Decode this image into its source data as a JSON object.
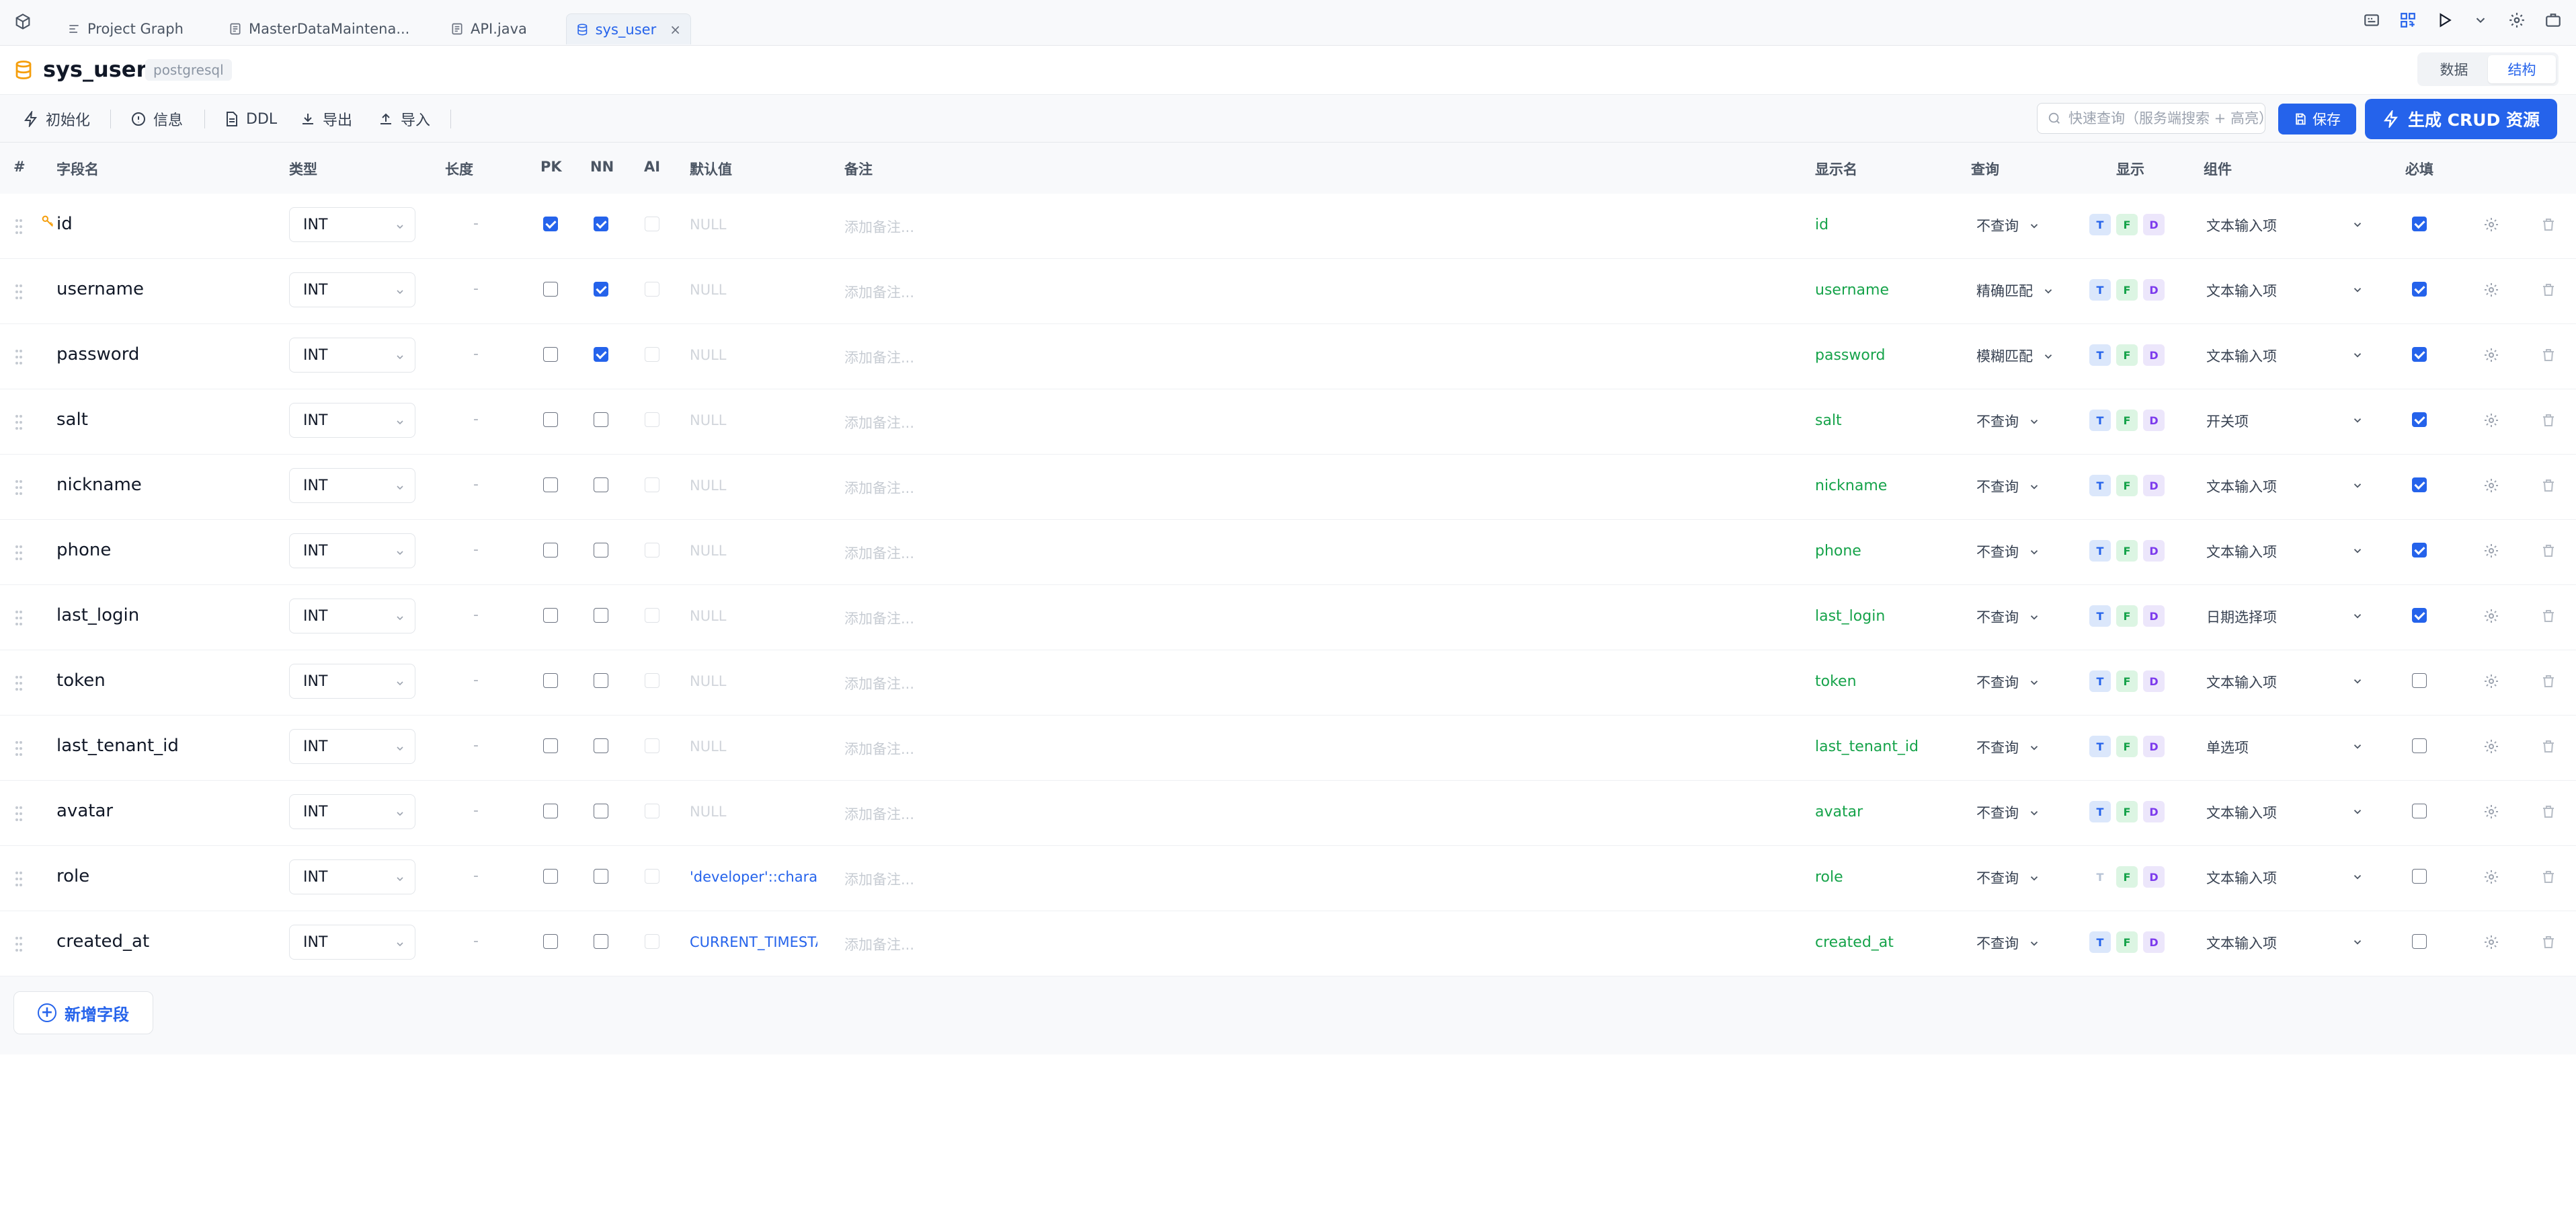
{
  "tabs": [
    {
      "label": "Project Graph",
      "icon": "graph-doc-icon",
      "active": false
    },
    {
      "label": "MasterDataMaintena...",
      "icon": "file-icon",
      "active": false
    },
    {
      "label": "API.java",
      "icon": "file-icon",
      "active": false
    },
    {
      "label": "sys_user",
      "icon": "database-icon",
      "active": true
    }
  ],
  "title": {
    "table_name": "sys_user",
    "db_type": "postgresql"
  },
  "view_toggle": {
    "data_label": "数据",
    "structure_label": "结构",
    "active": "structure"
  },
  "toolbar": {
    "init_label": "初始化",
    "info_label": "信息",
    "ddl_label": "DDL",
    "export_label": "导出",
    "import_label": "导入",
    "search_placeholder": "快速查询（服务端搜索 + 高亮）",
    "save_label": "保存",
    "generate_label": "生成 CRUD 资源"
  },
  "columns": {
    "num": "#",
    "name": "字段名",
    "type": "类型",
    "length": "长度",
    "pk": "PK",
    "nn": "NN",
    "ai": "AI",
    "default": "默认值",
    "note": "备注",
    "display_name": "显示名",
    "query": "查询",
    "show": "显示",
    "component": "组件",
    "required": "必填"
  },
  "placeholders": {
    "default": "NULL",
    "note": "添加备注..."
  },
  "length_placeholder": "-",
  "tag_letters": {
    "t": "T",
    "f": "F",
    "d": "D"
  },
  "fields": [
    {
      "name": "id",
      "type": "INT",
      "pk": true,
      "nn": true,
      "default": "",
      "display": "id",
      "query": "不查询",
      "t": true,
      "component": "文本输入项",
      "required": true
    },
    {
      "name": "username",
      "type": "INT",
      "pk": false,
      "nn": true,
      "default": "",
      "display": "username",
      "query": "精确匹配",
      "t": true,
      "component": "文本输入项",
      "required": true
    },
    {
      "name": "password",
      "type": "INT",
      "pk": false,
      "nn": true,
      "default": "",
      "display": "password",
      "query": "模糊匹配",
      "t": true,
      "component": "文本输入项",
      "required": true
    },
    {
      "name": "salt",
      "type": "INT",
      "pk": false,
      "nn": false,
      "default": "",
      "display": "salt",
      "query": "不查询",
      "t": true,
      "component": "开关项",
      "required": true
    },
    {
      "name": "nickname",
      "type": "INT",
      "pk": false,
      "nn": false,
      "default": "",
      "display": "nickname",
      "query": "不查询",
      "t": true,
      "component": "文本输入项",
      "required": true
    },
    {
      "name": "phone",
      "type": "INT",
      "pk": false,
      "nn": false,
      "default": "",
      "display": "phone",
      "query": "不查询",
      "t": true,
      "component": "文本输入项",
      "required": true
    },
    {
      "name": "last_login",
      "type": "INT",
      "pk": false,
      "nn": false,
      "default": "",
      "display": "last_login",
      "query": "不查询",
      "t": true,
      "component": "日期选择项",
      "required": true
    },
    {
      "name": "token",
      "type": "INT",
      "pk": false,
      "nn": false,
      "default": "",
      "display": "token",
      "query": "不查询",
      "t": true,
      "component": "文本输入项",
      "required": false
    },
    {
      "name": "last_tenant_id",
      "type": "INT",
      "pk": false,
      "nn": false,
      "default": "",
      "display": "last_tenant_id",
      "query": "不查询",
      "t": true,
      "component": "单选项",
      "required": false
    },
    {
      "name": "avatar",
      "type": "INT",
      "pk": false,
      "nn": false,
      "default": "",
      "display": "avatar",
      "query": "不查询",
      "t": true,
      "component": "文本输入项",
      "required": false
    },
    {
      "name": "role",
      "type": "INT",
      "pk": false,
      "nn": false,
      "default": "'developer'::character varying",
      "display": "role",
      "query": "不查询",
      "t": false,
      "component": "文本输入项",
      "required": false
    },
    {
      "name": "created_at",
      "type": "INT",
      "pk": false,
      "nn": false,
      "default": "CURRENT_TIMESTAMP",
      "display": "created_at",
      "query": "不查询",
      "t": true,
      "component": "文本输入项",
      "required": false
    }
  ],
  "add_field_label": "新增字段",
  "colors": {
    "accent": "#2563eb",
    "display_green": "#16a34a",
    "tag_purple": "#7c3aed"
  }
}
